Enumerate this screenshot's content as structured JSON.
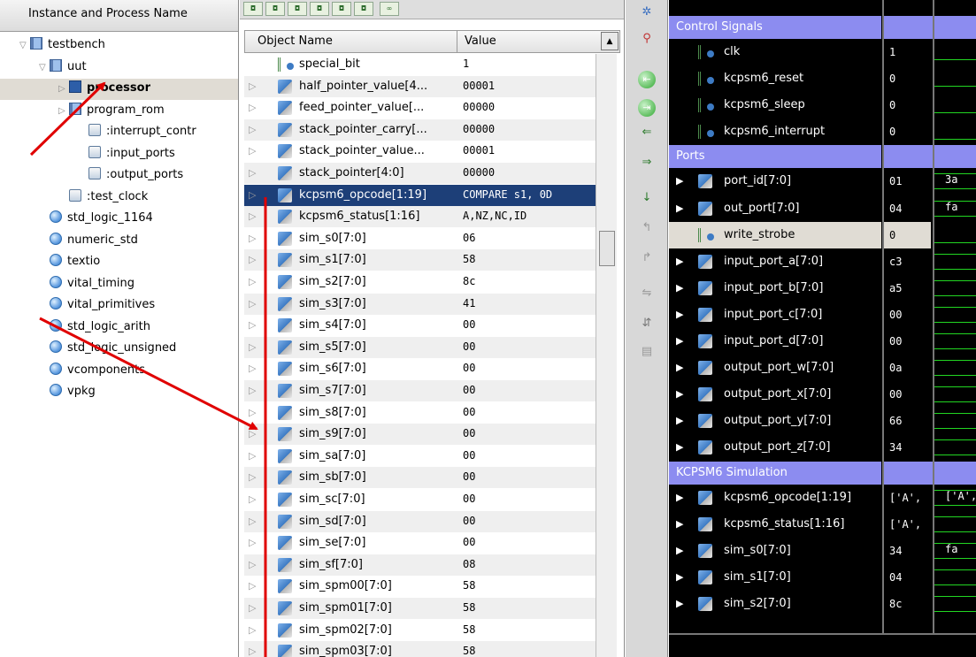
{
  "instance_pane": {
    "header": "Instance and Process Name",
    "items": [
      {
        "label": "testbench",
        "icon": "module-icon",
        "expander": "▽",
        "indent": 0
      },
      {
        "label": "uut",
        "icon": "module-icon",
        "expander": "▽",
        "indent": 1
      },
      {
        "label": "processor",
        "icon": "module-icon",
        "expander": "▷",
        "indent": 2,
        "selected": true,
        "bold": true
      },
      {
        "label": "program_rom",
        "icon": "module-icon",
        "expander": "▷",
        "indent": 2
      },
      {
        "label": ":interrupt_contr",
        "icon": "process-icon",
        "indent": 3
      },
      {
        "label": ":input_ports",
        "icon": "process-icon",
        "indent": 3
      },
      {
        "label": ":output_ports",
        "icon": "process-icon",
        "indent": 3
      },
      {
        "label": ":test_clock",
        "icon": "process-icon",
        "indent": 2,
        "alt": true
      },
      {
        "label": "std_logic_1164",
        "icon": "package-icon",
        "indent": 1
      },
      {
        "label": "numeric_std",
        "icon": "package-icon",
        "indent": 1
      },
      {
        "label": "textio",
        "icon": "package-icon",
        "indent": 1
      },
      {
        "label": "vital_timing",
        "icon": "package-icon",
        "indent": 1
      },
      {
        "label": "vital_primitives",
        "icon": "package-icon",
        "indent": 1
      },
      {
        "label": "std_logic_arith",
        "icon": "package-icon",
        "indent": 1
      },
      {
        "label": "std_logic_unsigned",
        "icon": "package-icon",
        "indent": 1
      },
      {
        "label": "vcomponents",
        "icon": "package-icon",
        "indent": 1
      },
      {
        "label": "vpkg",
        "icon": "package-icon",
        "indent": 1
      }
    ]
  },
  "object_pane": {
    "col_name": "Object Name",
    "col_value": "Value",
    "rows": [
      {
        "name": "special_bit",
        "value": "1",
        "kind": "bit"
      },
      {
        "name": "half_pointer_value[4...",
        "value": "00001",
        "kind": "bus"
      },
      {
        "name": "feed_pointer_value[...",
        "value": "00000",
        "kind": "bus"
      },
      {
        "name": "stack_pointer_carry[...",
        "value": "00000",
        "kind": "bus"
      },
      {
        "name": "stack_pointer_value...",
        "value": "00001",
        "kind": "bus"
      },
      {
        "name": "stack_pointer[4:0]",
        "value": "00000",
        "kind": "bus"
      },
      {
        "name": "kcpsm6_opcode[1:19]",
        "value": "COMPARE s1, 0D",
        "kind": "bus",
        "selected": true
      },
      {
        "name": "kcpsm6_status[1:16]",
        "value": "A,NZ,NC,ID",
        "kind": "bus"
      },
      {
        "name": "sim_s0[7:0]",
        "value": "06",
        "kind": "bus"
      },
      {
        "name": "sim_s1[7:0]",
        "value": "58",
        "kind": "bus"
      },
      {
        "name": "sim_s2[7:0]",
        "value": "8c",
        "kind": "bus"
      },
      {
        "name": "sim_s3[7:0]",
        "value": "41",
        "kind": "bus"
      },
      {
        "name": "sim_s4[7:0]",
        "value": "00",
        "kind": "bus"
      },
      {
        "name": "sim_s5[7:0]",
        "value": "00",
        "kind": "bus"
      },
      {
        "name": "sim_s6[7:0]",
        "value": "00",
        "kind": "bus"
      },
      {
        "name": "sim_s7[7:0]",
        "value": "00",
        "kind": "bus"
      },
      {
        "name": "sim_s8[7:0]",
        "value": "00",
        "kind": "bus"
      },
      {
        "name": "sim_s9[7:0]",
        "value": "00",
        "kind": "bus"
      },
      {
        "name": "sim_sa[7:0]",
        "value": "00",
        "kind": "bus"
      },
      {
        "name": "sim_sb[7:0]",
        "value": "00",
        "kind": "bus"
      },
      {
        "name": "sim_sc[7:0]",
        "value": "00",
        "kind": "bus"
      },
      {
        "name": "sim_sd[7:0]",
        "value": "00",
        "kind": "bus"
      },
      {
        "name": "sim_se[7:0]",
        "value": "00",
        "kind": "bus"
      },
      {
        "name": "sim_sf[7:0]",
        "value": "08",
        "kind": "bus"
      },
      {
        "name": "sim_spm00[7:0]",
        "value": "58",
        "kind": "bus"
      },
      {
        "name": "sim_spm01[7:0]",
        "value": "58",
        "kind": "bus"
      },
      {
        "name": "sim_spm02[7:0]",
        "value": "58",
        "kind": "bus"
      },
      {
        "name": "sim_spm03[7:0]",
        "value": "58",
        "kind": "bus"
      }
    ]
  },
  "wave": {
    "rows": [
      {
        "type": "group",
        "label": "Control Signals"
      },
      {
        "type": "signal",
        "name": "clk",
        "value": "1",
        "kind": "bit"
      },
      {
        "type": "signal",
        "name": "kcpsm6_reset",
        "value": "0",
        "kind": "bit"
      },
      {
        "type": "signal",
        "name": "kcpsm6_sleep",
        "value": "0",
        "kind": "bit"
      },
      {
        "type": "signal",
        "name": "kcpsm6_interrupt",
        "value": "0",
        "kind": "bit"
      },
      {
        "type": "group",
        "label": "Ports"
      },
      {
        "type": "signal",
        "name": "port_id[7:0]",
        "value": "01",
        "kind": "bus",
        "wave_label": "3a"
      },
      {
        "type": "signal",
        "name": "out_port[7:0]",
        "value": "04",
        "kind": "bus",
        "wave_label": "fa"
      },
      {
        "type": "signal",
        "name": "write_strobe",
        "value": "0",
        "kind": "bit",
        "selected": true
      },
      {
        "type": "signal",
        "name": "input_port_a[7:0]",
        "value": "c3",
        "kind": "bus"
      },
      {
        "type": "signal",
        "name": "input_port_b[7:0]",
        "value": "a5",
        "kind": "bus"
      },
      {
        "type": "signal",
        "name": "input_port_c[7:0]",
        "value": "00",
        "kind": "bus"
      },
      {
        "type": "signal",
        "name": "input_port_d[7:0]",
        "value": "00",
        "kind": "bus"
      },
      {
        "type": "signal",
        "name": "output_port_w[7:0]",
        "value": "0a",
        "kind": "bus"
      },
      {
        "type": "signal",
        "name": "output_port_x[7:0]",
        "value": "00",
        "kind": "bus"
      },
      {
        "type": "signal",
        "name": "output_port_y[7:0]",
        "value": "66",
        "kind": "bus"
      },
      {
        "type": "signal",
        "name": "output_port_z[7:0]",
        "value": "34",
        "kind": "bus"
      },
      {
        "type": "group",
        "label": "KCPSM6 Simulation"
      },
      {
        "type": "signal",
        "name": "kcpsm6_opcode[1:19]",
        "value": "['A',",
        "kind": "bus",
        "wave_label": "['A','"
      },
      {
        "type": "signal",
        "name": "kcpsm6_status[1:16]",
        "value": "['A',",
        "kind": "bus"
      },
      {
        "type": "signal",
        "name": "sim_s0[7:0]",
        "value": "34",
        "kind": "bus",
        "wave_label": "fa"
      },
      {
        "type": "signal",
        "name": "sim_s1[7:0]",
        "value": "04",
        "kind": "bus"
      },
      {
        "type": "signal",
        "name": "sim_s2[7:0]",
        "value": "8c",
        "kind": "bus"
      }
    ]
  },
  "colors": {
    "selection": "#1d3f78",
    "group_header": "#8c8cf0",
    "wave_green": "#22d622",
    "arrow_red": "#e00000"
  }
}
